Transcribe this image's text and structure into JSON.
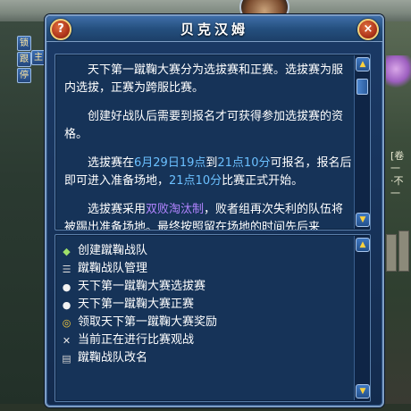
{
  "side_buttons": [
    "锁",
    "跟",
    "停"
  ],
  "side_button_extra": "主",
  "right_side_text": [
    "[卷",
    "一",
    "·不",
    "一"
  ],
  "dialog": {
    "title": "贝克汉姆",
    "help_label": "?",
    "close_label": "×"
  },
  "description": {
    "p1": "天下第一蹴鞠大赛分为选拔赛和正赛。选拔赛为服内选拔，正赛为跨服比赛。",
    "p2": "创建好战队后需要到报名才可获得参加选拔赛的资格。",
    "p3_a": "选拔赛在",
    "p3_date": "6月29日19点",
    "p3_b": "到",
    "p3_time1": "21点10分",
    "p3_c": "可报名，报名后即可进入准备场地，",
    "p3_time2": "21点10分",
    "p3_d": "比赛正式开始。",
    "p4_a": "选拔赛采用",
    "p4_hl": "双败淘汰制",
    "p4_b": "，败者组再次失利的队伍将被踢出准备场地。最终按照留在场地的时间先后来"
  },
  "menu": {
    "items": [
      {
        "label": "创建蹴鞠战队",
        "icon": "diamond-icon"
      },
      {
        "label": "蹴鞠战队管理",
        "icon": "list-icon"
      },
      {
        "label": "天下第一蹴鞠大赛选拔赛",
        "icon": "speech-bubble-icon"
      },
      {
        "label": "天下第一蹴鞠大赛正赛",
        "icon": "speech-bubble-icon"
      },
      {
        "label": "领取天下第一蹴鞠大赛奖励",
        "icon": "coin-icon"
      },
      {
        "label": "当前正在进行比赛观战",
        "icon": "crossed-swords-icon"
      },
      {
        "label": "蹴鞠战队改名",
        "icon": "document-icon"
      }
    ]
  },
  "colors": {
    "panel_bg": "#163358",
    "text_highlight": "#6bc0ff",
    "text_highlight_purple": "#b184ff",
    "border": "#7d9dc4"
  }
}
